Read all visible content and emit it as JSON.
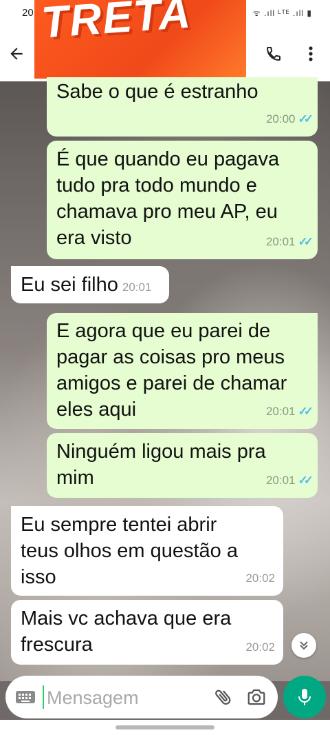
{
  "status_bar": {
    "time": "20",
    "icons": "ᯤ .ıll ᴸᵀᴱ .ıll ▮"
  },
  "banner": {
    "text": "TRETA"
  },
  "header_icons": {
    "back": "arrow-left-icon",
    "call": "phone-icon",
    "menu": "more-vert-icon"
  },
  "messages": [
    {
      "direction": "outgoing",
      "text": "Sabe o que é estranho",
      "time": "20:00",
      "read": true
    },
    {
      "direction": "outgoing",
      "text": "É que quando eu pagava\ntudo pra todo mundo e\nchamava pro meu AP, eu\nera visto",
      "time": "20:01",
      "read": true
    },
    {
      "direction": "incoming",
      "text": "Eu sei filho",
      "time": "20:01"
    },
    {
      "direction": "outgoing",
      "text": "E agora que eu parei de\npagar as coisas pro meus\namigos e parei de chamar\neles aqui",
      "time": "20:01",
      "read": true
    },
    {
      "direction": "outgoing",
      "text": "Ninguém ligou mais pra\nmim",
      "time": "20:01",
      "read": true
    },
    {
      "direction": "incoming",
      "text": "Eu sempre tentei abrir\nteus olhos em questão a\nisso",
      "time": "20:02"
    },
    {
      "direction": "incoming",
      "text": "Mais vc achava que era\nfrescura",
      "time": "20:02"
    }
  ],
  "read_ticks": "✓✓",
  "composer": {
    "placeholder": "Mensagem",
    "value": ""
  },
  "colors": {
    "outgoing_bubble": "#e5fdd0",
    "incoming_bubble": "#ffffff",
    "accent": "#00a884",
    "read_ticks": "#53bdeb"
  }
}
